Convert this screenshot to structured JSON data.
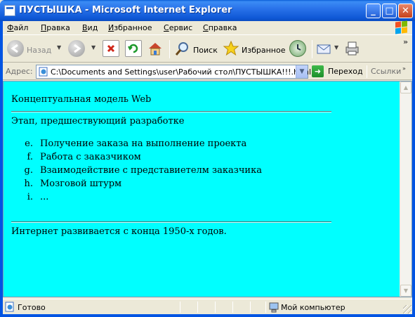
{
  "window": {
    "title": "ПУСТЫШКА - Microsoft Internet Explorer",
    "controls": {
      "minimize": "_",
      "maximize": "□",
      "close": "✕"
    }
  },
  "menubar": {
    "items": [
      {
        "label": "Файл",
        "underline": "Ф",
        "rest": "айл"
      },
      {
        "label": "Правка",
        "underline": "П",
        "rest": "равка"
      },
      {
        "label": "Вид",
        "underline": "В",
        "rest": "ид"
      },
      {
        "label": "Избранное",
        "underline": "И",
        "rest": "збранное"
      },
      {
        "label": "Сервис",
        "underline": "С",
        "rest": "ервис"
      },
      {
        "label": "Справка",
        "underline": "С",
        "rest": "правка"
      }
    ]
  },
  "toolbar": {
    "back_label": "Назад",
    "search_label": "Поиск",
    "favorites_label": "Избранное",
    "more_glyph": "»"
  },
  "addressbar": {
    "label": "Адрес:",
    "value": "C:\\Documents and Settings\\user\\Рабочий стол\\ПУСТЫШКА!!!.html",
    "go_label": "Переход",
    "links_label": "Ссылки",
    "links_glyph": "»"
  },
  "page": {
    "heading": "Концептуальная модель Web",
    "section_title": "Этап, предшествующий разработке",
    "list": [
      {
        "marker": "e.",
        "text": "Получение заказа на выполнение проекта"
      },
      {
        "marker": "f.",
        "text": "Работа с заказчиком"
      },
      {
        "marker": "g.",
        "text": "Взаимодействие с представиетелм заказчика"
      },
      {
        "marker": "h.",
        "text": "Мозговой штурм"
      },
      {
        "marker": "i.",
        "text": "..."
      }
    ],
    "footer_text": "Интернет развивается с конца 1950-х годов.",
    "background_color": "#00ffff"
  },
  "statusbar": {
    "status": "Готово",
    "zone": "Мой компьютер"
  },
  "icons": {
    "scroll_up": "▲",
    "scroll_down": "▼",
    "dropdown": "▼",
    "go_arrow": "➜"
  }
}
